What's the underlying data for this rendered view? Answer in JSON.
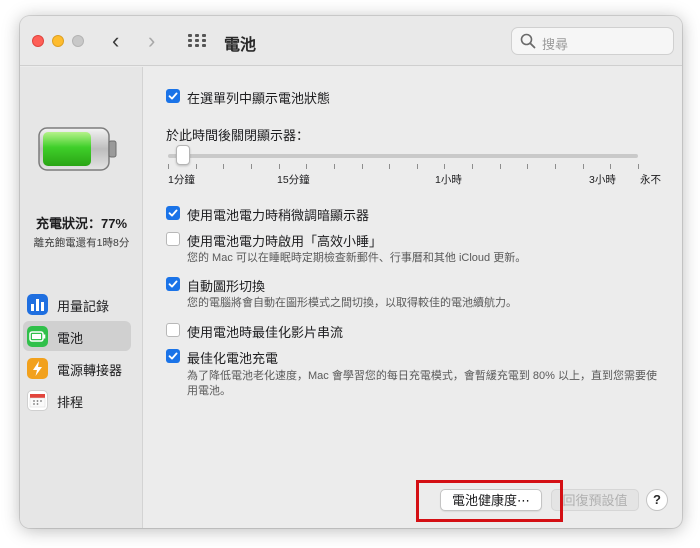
{
  "window": {
    "title": "電池",
    "search_placeholder": "搜尋",
    "nav_back": "‹",
    "nav_forward": "›"
  },
  "sidebar": {
    "charge_status": "充電狀況：77%",
    "time_to_full": "離充飽電還有1時8分",
    "battery_level": 0.77,
    "items": [
      {
        "label": "用量記錄",
        "icon": "usage-history-icon",
        "color": "#1f6fe0",
        "selected": false
      },
      {
        "label": "電池",
        "icon": "battery-icon",
        "color": "#30c04a",
        "selected": true
      },
      {
        "label": "電源轉接器",
        "icon": "power-adapter-icon",
        "color": "#f2a11d",
        "selected": false
      },
      {
        "label": "排程",
        "icon": "schedule-icon",
        "color": "#ffffff",
        "selected": false
      }
    ]
  },
  "options": {
    "show_in_menu_bar": {
      "label": "在選單列中顯示電池狀態",
      "checked": true
    },
    "display_off_label": "於此時間後關閉顯示器：",
    "display_off_slider": {
      "tick_labels": [
        "1分鐘",
        "15分鐘",
        "1小時",
        "3小時",
        "永不"
      ],
      "value": "1分鐘"
    },
    "dim_display": {
      "label": "使用電池電力時稍微調暗顯示器",
      "checked": true
    },
    "power_nap": {
      "label": "使用電池電力時啟用「高效小睡」",
      "checked": false,
      "description": "您的 Mac 可以在睡眠時定期檢查新郵件、行事曆和其他 iCloud 更新。"
    },
    "graphics_switching": {
      "label": "自動圖形切換",
      "checked": true,
      "description": "您的電腦將會自動在圖形模式之間切換，以取得較佳的電池續航力。"
    },
    "optimize_video": {
      "label": "使用電池時最佳化影片串流",
      "checked": false
    },
    "optimized_charging": {
      "label": "最佳化電池充電",
      "checked": true,
      "description_line1": "為了降低電池老化速度，Mac 會學習您的每日充電模式，會暫緩充電到 80% 以上，直到您需要使",
      "description_line2": "用電池。"
    }
  },
  "footer": {
    "battery_health_button": "電池健康度⋯",
    "restore_defaults_button": "回復預設值",
    "help_button": "?"
  },
  "colors": {
    "accent": "#1a73e8",
    "highlight_box": "#d40f14"
  }
}
